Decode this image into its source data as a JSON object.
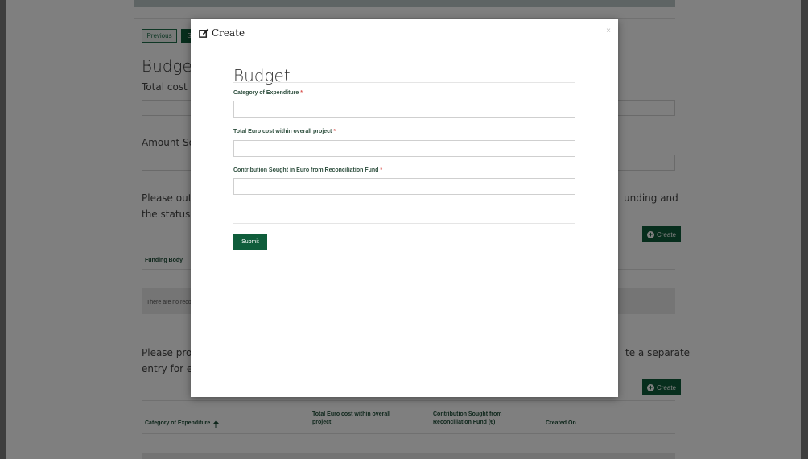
{
  "background_page": {
    "prev_label": "Previous",
    "next_label": "S",
    "heading": "Budget",
    "field1_label": "Total cost of t",
    "field2_label": "Amount Soug",
    "para1_left_line1": "Please outlin",
    "para1_left_line2": "the status of",
    "para1_right_line1": "unding and",
    "create_label": "Create",
    "table1_header_col1": "Funding Body",
    "empty_message": "There are no reco",
    "para2_left_line1": "Please provid",
    "para2_left_line2": "entry for eacl",
    "para2_right_line1": "te a separate",
    "table2_headers": {
      "category": "Category of Expenditure",
      "total_cost_line1": "Total Euro cost within overall",
      "total_cost_line2": "project",
      "contribution_line1": "Contribution Sought from",
      "contribution_line2": "Reconciliation Fund (€)",
      "created_on": "Created On"
    }
  },
  "modal": {
    "title": "Create",
    "close_symbol": "×",
    "form_title": "Budget",
    "fields": [
      {
        "label": "Category of Expenditure",
        "required_mark": "*",
        "value": ""
      },
      {
        "label": "Total Euro cost within overall project",
        "required_mark": "*",
        "value": ""
      },
      {
        "label": "Contribution Sought in Euro from Reconciliation Fund",
        "required_mark": "*",
        "value": ""
      }
    ],
    "submit_label": "Submit"
  },
  "icons": {
    "modal_title_icon": "edit-icon",
    "create_icon": "plus-circle-icon",
    "sort_icon": "arrow-up-icon"
  },
  "colors": {
    "primary_green": "#0f5d3b",
    "required_red": "#d9534f"
  }
}
